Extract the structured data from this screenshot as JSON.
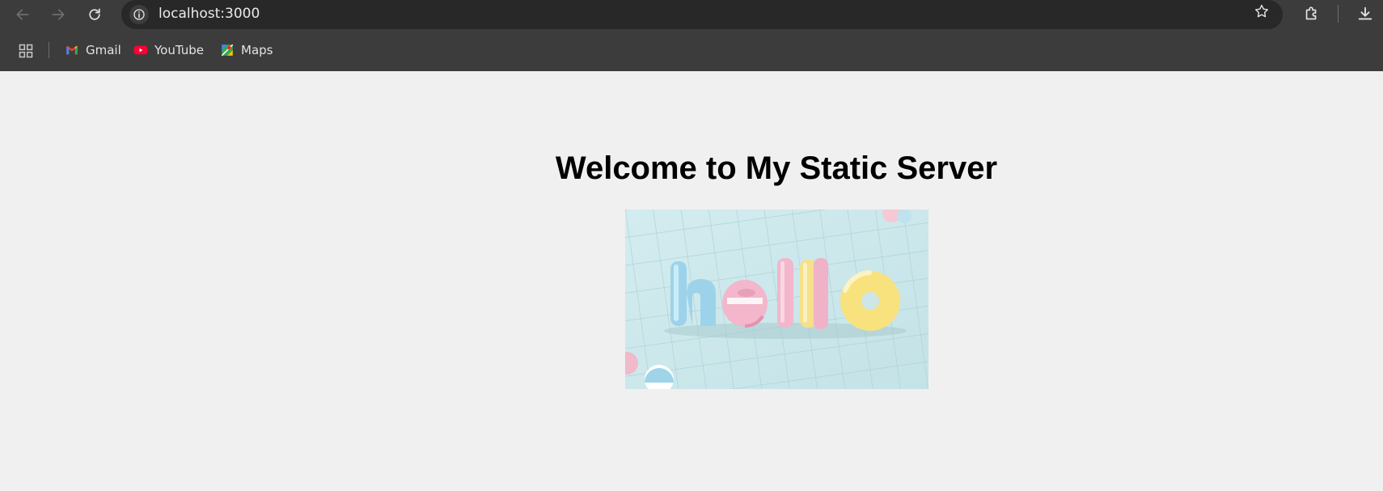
{
  "browser": {
    "url": "localhost:3000",
    "bookmarks": [
      {
        "label": "Gmail",
        "icon": "gmail-icon"
      },
      {
        "label": "YouTube",
        "icon": "youtube-icon"
      },
      {
        "label": "Maps",
        "icon": "maps-icon"
      }
    ]
  },
  "page": {
    "title": "Welcome to My Static Server",
    "image": {
      "text": "hello"
    }
  },
  "colors": {
    "toolbar_bg": "#3c3c3c",
    "omnibox_bg": "#282828",
    "page_bg": "#f0f0f0"
  }
}
